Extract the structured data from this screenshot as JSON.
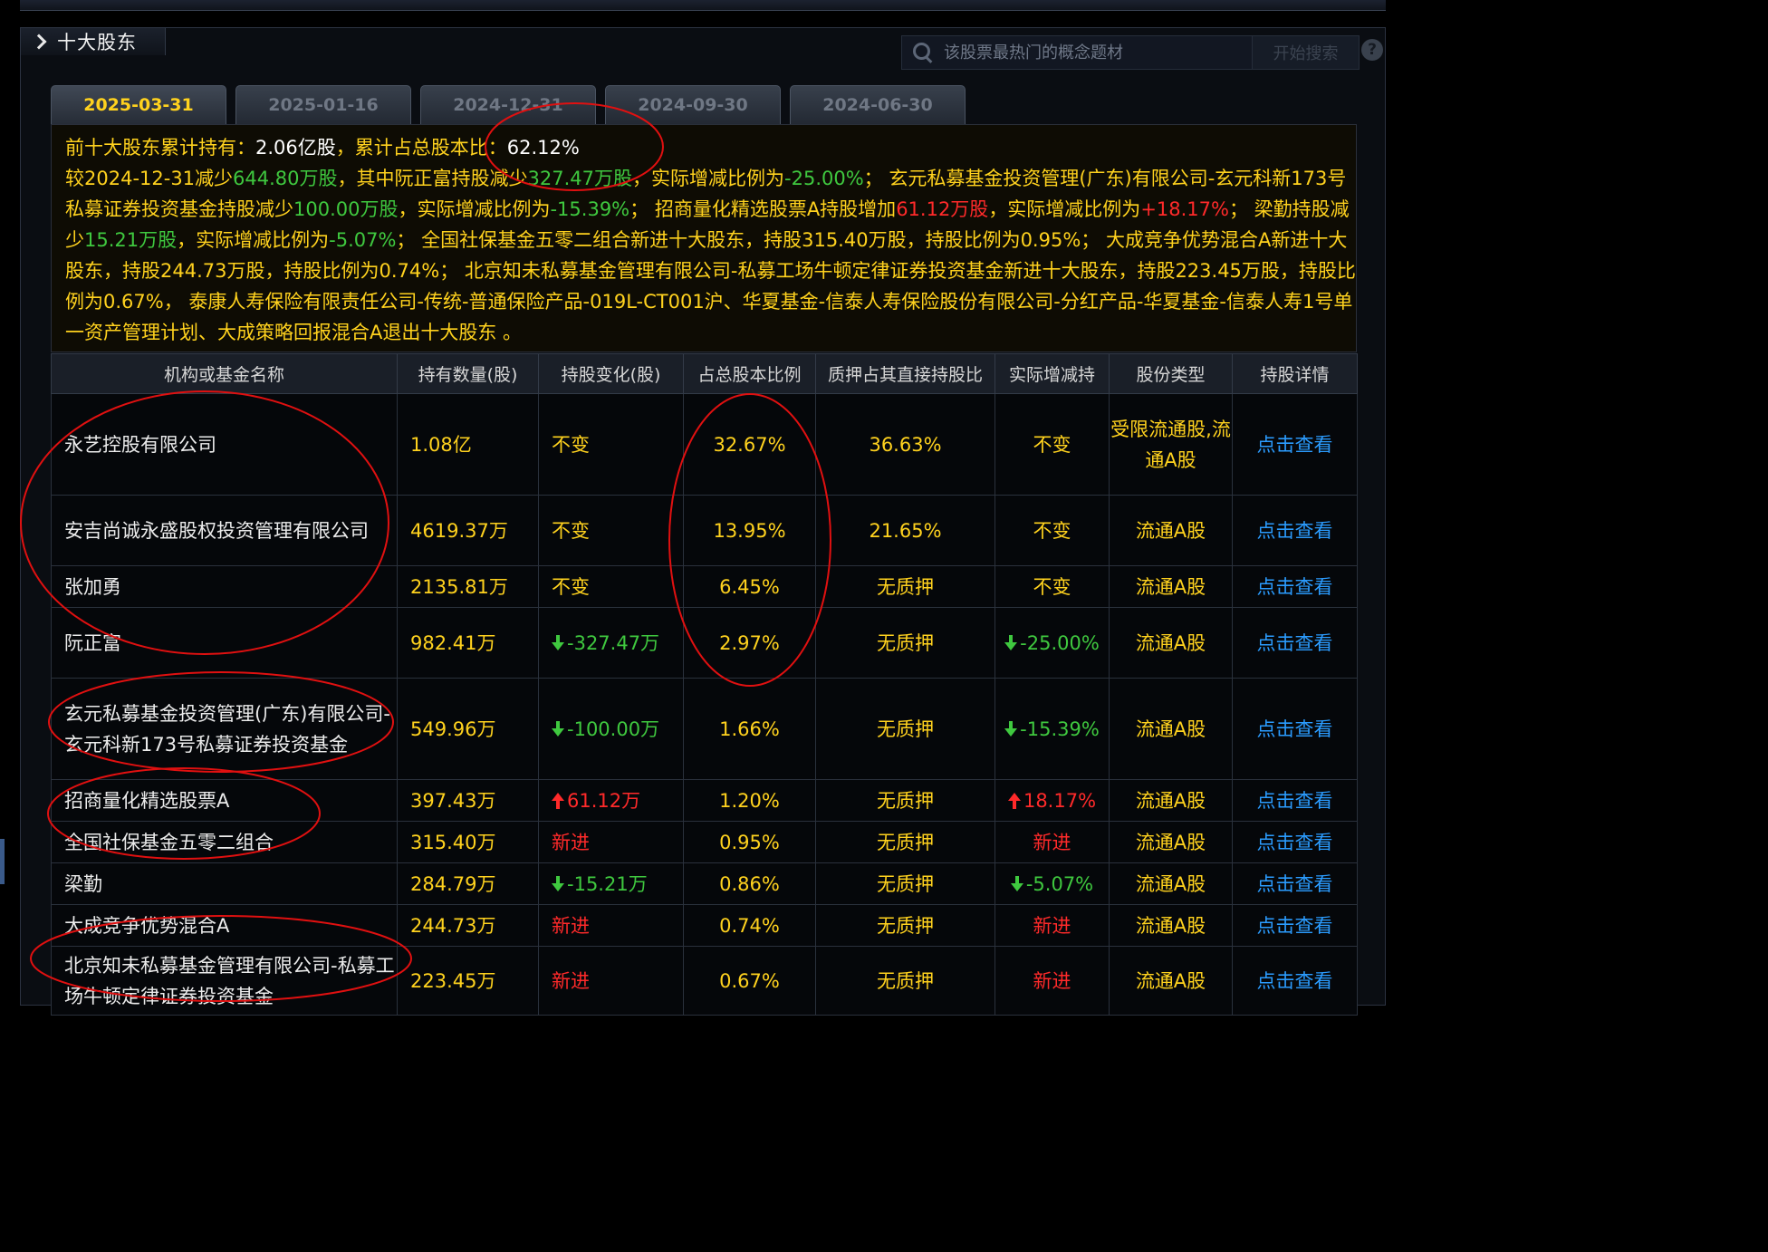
{
  "section": {
    "title": "十大股东"
  },
  "search": {
    "placeholder": "该股票最热门的概念题材",
    "button": "开始搜索",
    "help": "?"
  },
  "tabs": [
    {
      "label": "2025-03-31",
      "active": true
    },
    {
      "label": "2025-01-16",
      "active": false
    },
    {
      "label": "2024-12-31",
      "active": false
    },
    {
      "label": "2024-09-30",
      "active": false
    },
    {
      "label": "2024-06-30",
      "active": false
    }
  ],
  "summary": {
    "l1a": "前十大股东累计持有：",
    "l1b": "2.06亿股",
    "l1c": "，累计占总股本比：",
    "l1d": "62.12%",
    "s1": "较2024-12-31减少",
    "s2": "644.80万股",
    "s3": "，其中阮正富持股减少",
    "s4": "327.47万股",
    "s5": "，实际增减比例为",
    "s6": "-25.00%",
    "s7": "； 玄元私募基金投资管理(广东)有限公司-玄元科新173号私募证券投资基金持股减少",
    "s8": "100.00万股",
    "s9": "，实际增减比例为",
    "s10": "-15.39%",
    "s11": "； 招商量化精选股票A持股增加",
    "s12": "61.12万股",
    "s13": "，实际增减比例为",
    "s14": "+18.17%",
    "s15": "； 梁勤持股减少",
    "s16": "15.21万股",
    "s17": "，实际增减比例为",
    "s18": "-5.07%",
    "s19": "； 全国社保基金五零二组合新进十大股东，持股315.40万股，持股比例为0.95%； 大成竞争优势混合A新进十大股东，持股244.73万股，持股比例为0.74%； 北京知未私募基金管理有限公司-私募工场牛顿定律证券投资基金新进十大股东，持股223.45万股，持股比例为0.67%， 泰康人寿保险有限责任公司-传统-普通保险产品-019L-CT001沪、华夏基金-信泰人寿保险股份有限公司-分红产品-华夏基金-信泰人寿1号单一资产管理计划、大成策略回报混合A退出十大股东 。"
  },
  "table": {
    "headers": [
      "机构或基金名称",
      "持有数量(股)",
      "持股变化(股)",
      "占总股本比例",
      "质押占其直接持股比",
      "实际增减持",
      "股份类型",
      "持股详情"
    ],
    "rows": [
      {
        "name": "永艺控股有限公司",
        "qty": "1.08亿",
        "chg": "不变",
        "chg_dir": "none",
        "ratio": "32.67%",
        "pledge": "36.63%",
        "actual": "不变",
        "actual_dir": "none",
        "type": "受限流通股,流通A股",
        "detail": "点击查看"
      },
      {
        "name": "安吉尚诚永盛股权投资管理有限公司",
        "qty": "4619.37万",
        "chg": "不变",
        "chg_dir": "none",
        "ratio": "13.95%",
        "pledge": "21.65%",
        "actual": "不变",
        "actual_dir": "none",
        "type": "流通A股",
        "detail": "点击查看"
      },
      {
        "name": "张加勇",
        "qty": "2135.81万",
        "chg": "不变",
        "chg_dir": "none",
        "ratio": "6.45%",
        "pledge": "无质押",
        "actual": "不变",
        "actual_dir": "none",
        "type": "流通A股",
        "detail": "点击查看"
      },
      {
        "name": "阮正富",
        "qty": "982.41万",
        "chg": "-327.47万",
        "chg_dir": "down",
        "ratio": "2.97%",
        "pledge": "无质押",
        "actual": "-25.00%",
        "actual_dir": "down",
        "type": "流通A股",
        "detail": "点击查看"
      },
      {
        "name": "玄元私募基金投资管理(广东)有限公司-玄元科新173号私募证券投资基金",
        "qty": "549.96万",
        "chg": "-100.00万",
        "chg_dir": "down",
        "ratio": "1.66%",
        "pledge": "无质押",
        "actual": "-15.39%",
        "actual_dir": "down",
        "type": "流通A股",
        "detail": "点击查看"
      },
      {
        "name": "招商量化精选股票A",
        "qty": "397.43万",
        "chg": "61.12万",
        "chg_dir": "up",
        "ratio": "1.20%",
        "pledge": "无质押",
        "actual": "18.17%",
        "actual_dir": "up",
        "type": "流通A股",
        "detail": "点击查看"
      },
      {
        "name": "全国社保基金五零二组合",
        "qty": "315.40万",
        "chg": "新进",
        "chg_dir": "new",
        "ratio": "0.95%",
        "pledge": "无质押",
        "actual": "新进",
        "actual_dir": "new",
        "type": "流通A股",
        "detail": "点击查看"
      },
      {
        "name": "梁勤",
        "qty": "284.79万",
        "chg": "-15.21万",
        "chg_dir": "down",
        "ratio": "0.86%",
        "pledge": "无质押",
        "actual": "-5.07%",
        "actual_dir": "down",
        "type": "流通A股",
        "detail": "点击查看"
      },
      {
        "name": "大成竞争优势混合A",
        "qty": "244.73万",
        "chg": "新进",
        "chg_dir": "new",
        "ratio": "0.74%",
        "pledge": "无质押",
        "actual": "新进",
        "actual_dir": "new",
        "type": "流通A股",
        "detail": "点击查看"
      },
      {
        "name": "北京知未私募基金管理有限公司-私募工场牛顿定律证券投资基金",
        "qty": "223.45万",
        "chg": "新进",
        "chg_dir": "new",
        "ratio": "0.67%",
        "pledge": "无质押",
        "actual": "新进",
        "actual_dir": "new",
        "type": "流通A股",
        "detail": "点击查看"
      }
    ]
  },
  "colors": {
    "accent": "#ffd21e",
    "up": "#ff2a2a",
    "down": "#3fc83f",
    "link": "#2b9cff",
    "annotation": "#e01010"
  }
}
